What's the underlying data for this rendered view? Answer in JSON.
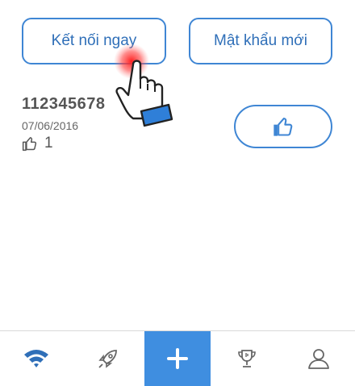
{
  "actions": {
    "connect_label": "Kết nối ngay",
    "new_password_label": "Mật khẩu mới"
  },
  "network": {
    "name": "112345678",
    "date": "07/06/2016",
    "likes": "1"
  },
  "tabbar": {
    "tabs": [
      {
        "icon": "wifi-icon",
        "active": true
      },
      {
        "icon": "rocket-icon"
      },
      {
        "icon": "plus-icon"
      },
      {
        "icon": "trophy-icon"
      },
      {
        "icon": "profile-icon"
      }
    ]
  },
  "colors": {
    "accent": "#3f86d4",
    "tab_center_bg": "#3f8ee0"
  }
}
